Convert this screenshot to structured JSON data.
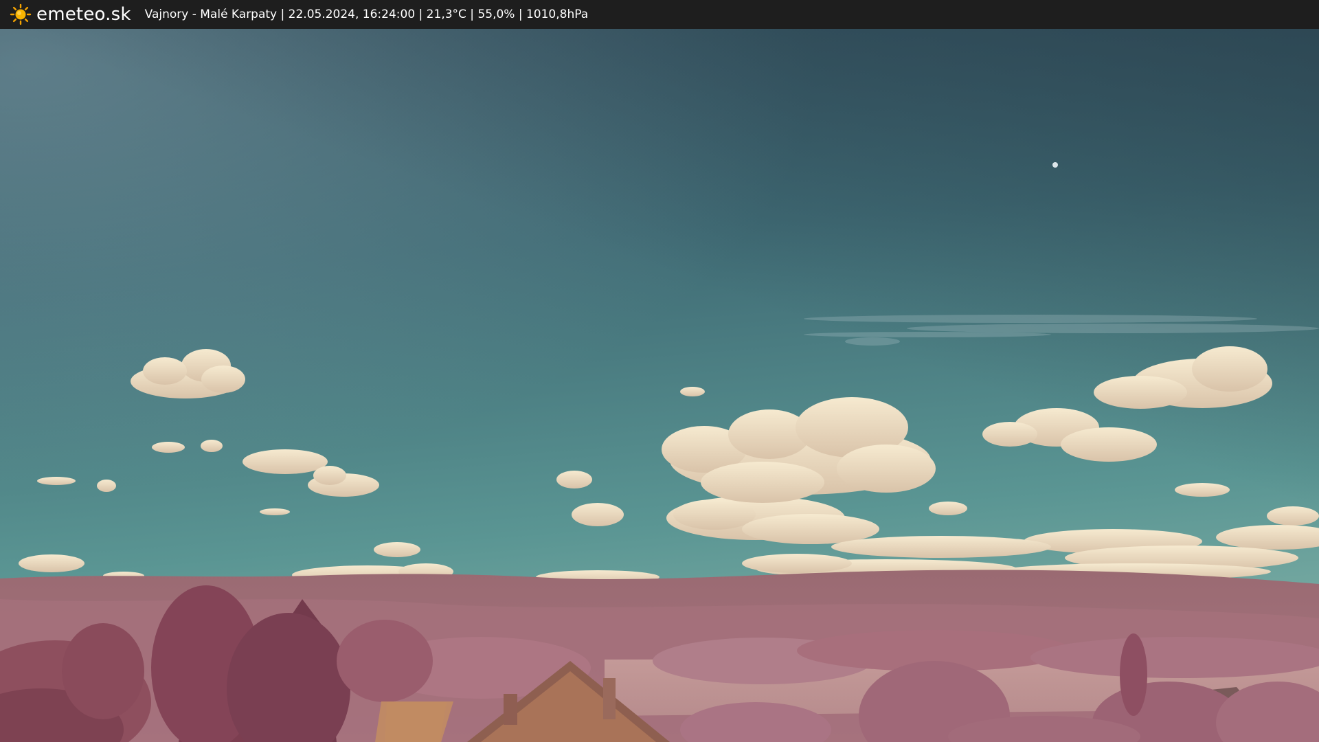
{
  "header": {
    "brand": "emeteo.sk",
    "logo_icon": "sun-icon",
    "status_text": "Vajnory - Malé Karpaty | 22.05.2024, 16:24:00 | 21,3°C | 55,0% | 1010,8hPa",
    "accent_color": "#f5a300"
  },
  "webcam": {
    "image_icon": "webcam-image",
    "sky_top_color": "#2f4655",
    "sky_horizon_color": "#5e9a97",
    "foliage_color": "#a9707c",
    "cloud_color": "#f1e3c6"
  }
}
